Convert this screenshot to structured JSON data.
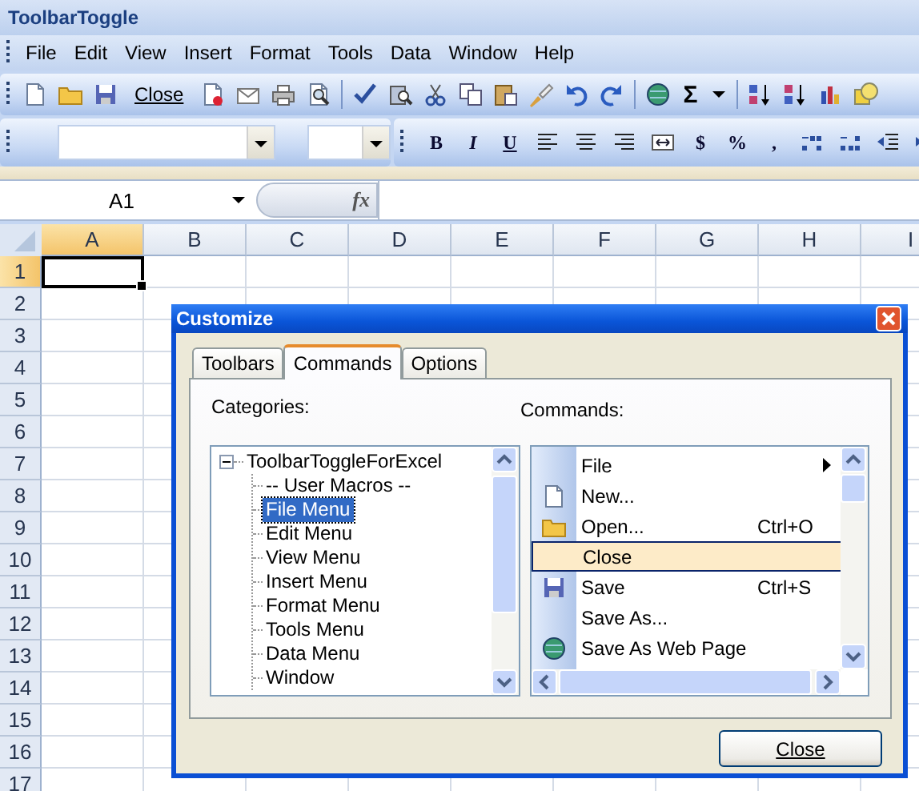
{
  "window": {
    "title": "ToolbarToggle"
  },
  "menu": [
    "File",
    "Edit",
    "View",
    "Insert",
    "Format",
    "Tools",
    "Data",
    "Window",
    "Help"
  ],
  "standard_toolbar": {
    "close_button": "Close",
    "autosum": "Σ"
  },
  "formatting_toolbar": {
    "bold": "B",
    "italic": "I",
    "underline": "U",
    "currency": "$",
    "percent": "%",
    "comma": ","
  },
  "formula_bar": {
    "name_box": "A1",
    "function_label": "fx"
  },
  "sheet": {
    "columns": [
      {
        "label": "A",
        "selected": true
      },
      {
        "label": "B",
        "selected": false
      },
      {
        "label": "C",
        "selected": false
      },
      {
        "label": "D",
        "selected": false
      },
      {
        "label": "E",
        "selected": false
      },
      {
        "label": "F",
        "selected": false
      },
      {
        "label": "G",
        "selected": false
      },
      {
        "label": "H",
        "selected": false
      },
      {
        "label": "I",
        "selected": false
      }
    ],
    "rows": [
      {
        "label": "1",
        "selected": true
      },
      {
        "label": "2",
        "selected": false
      },
      {
        "label": "3",
        "selected": false
      },
      {
        "label": "4",
        "selected": false
      },
      {
        "label": "5",
        "selected": false
      },
      {
        "label": "6",
        "selected": false
      },
      {
        "label": "7",
        "selected": false
      },
      {
        "label": "8",
        "selected": false
      },
      {
        "label": "9",
        "selected": false
      },
      {
        "label": "10",
        "selected": false
      },
      {
        "label": "11",
        "selected": false
      },
      {
        "label": "12",
        "selected": false
      },
      {
        "label": "13",
        "selected": false
      },
      {
        "label": "14",
        "selected": false
      },
      {
        "label": "15",
        "selected": false
      },
      {
        "label": "16",
        "selected": false
      },
      {
        "label": "17",
        "selected": false
      }
    ]
  },
  "dialog": {
    "title": "Customize",
    "tabs": [
      {
        "label": "Toolbars",
        "selected": false
      },
      {
        "label": "Commands",
        "selected": true
      },
      {
        "label": "Options",
        "selected": false
      }
    ],
    "categories_label": "Categories:",
    "commands_label": "Commands:",
    "categories": [
      {
        "label": "ToolbarToggleForExcel",
        "expanded": true,
        "children": [
          {
            "label": "-- User Macros --",
            "selected": false
          },
          {
            "label": "File Menu",
            "selected": true
          },
          {
            "label": "Edit Menu",
            "selected": false
          },
          {
            "label": "View Menu",
            "selected": false
          },
          {
            "label": "Insert Menu",
            "selected": false
          },
          {
            "label": "Format Menu",
            "selected": false
          },
          {
            "label": "Tools Menu",
            "selected": false
          },
          {
            "label": "Data Menu",
            "selected": false
          },
          {
            "label": "Window",
            "selected": false
          }
        ]
      }
    ],
    "commands": [
      {
        "label": "File",
        "kind": "submenu",
        "selected": false
      },
      {
        "label": "New...",
        "kind": "document",
        "selected": false
      },
      {
        "label": "Open...",
        "shortcut": "Ctrl+O",
        "kind": "folder",
        "selected": false
      },
      {
        "label": "Close",
        "kind": "plain",
        "selected": true
      },
      {
        "label": "Save",
        "shortcut": "Ctrl+S",
        "kind": "disk",
        "selected": false
      },
      {
        "label": "Save As...",
        "kind": "plain",
        "selected": false
      },
      {
        "label": "Save As Web Page",
        "kind": "globe",
        "selected": false
      }
    ],
    "close_button": "Close"
  }
}
